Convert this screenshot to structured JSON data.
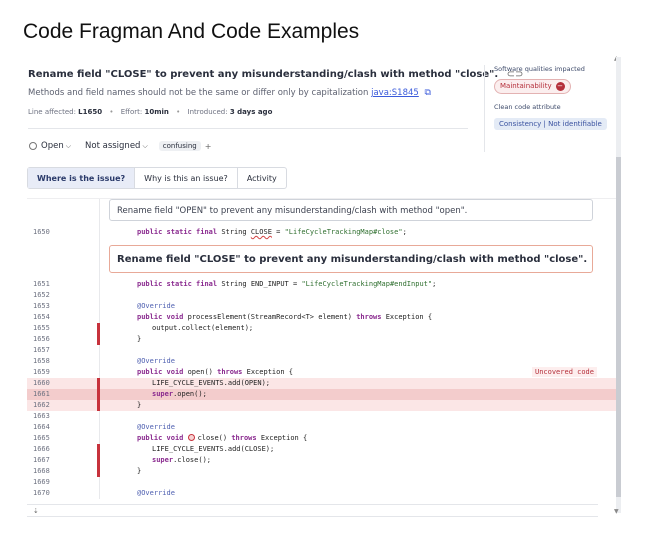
{
  "page_title": "Code Fragman And Code Examples",
  "issue": {
    "title": "Rename field \"CLOSE\" to prevent any misunderstanding/clash with method \"close\".",
    "description": "Methods and field names should not be the same or differ only by capitalization",
    "rule": "java:S1845",
    "line_label": "Line affected:",
    "line_value": "L1650",
    "effort_label": "Effort:",
    "effort_value": "10min",
    "introduced_label": "Introduced:",
    "introduced_value": "3 days ago",
    "status": "Open",
    "assignee": "Not assigned",
    "tag": "confusing",
    "tag_add": "+"
  },
  "tabs": [
    {
      "label": "Where is the issue?",
      "active": true
    },
    {
      "label": "Why is this an issue?",
      "active": false
    },
    {
      "label": "Activity",
      "active": false
    }
  ],
  "side": {
    "qualities_label": "Software qualities impacted",
    "quality_badge": "Maintainability",
    "attribute_label": "Clean code attribute",
    "attribute_badge": "Consistency | Not identifiable"
  },
  "code": {
    "secondary_message": "Rename field \"OPEN\" to prevent any misunderstanding/clash with method \"open\".",
    "primary_message": "Rename field \"CLOSE\" to prevent any misunderstanding/clash with method \"close\".",
    "uncovered_label": "Uncovered code",
    "lines": {
      "l1650": {
        "n": "1650"
      },
      "l1651": {
        "n": "1651"
      },
      "l1652": {
        "n": "1652"
      },
      "l1653": {
        "n": "1653"
      },
      "l1654": {
        "n": "1654"
      },
      "l1655": {
        "n": "1655"
      },
      "l1656": {
        "n": "1656"
      },
      "l1657": {
        "n": "1657"
      },
      "l1658": {
        "n": "1658"
      },
      "l1659": {
        "n": "1659"
      },
      "l1660": {
        "n": "1660"
      },
      "l1661": {
        "n": "1661"
      },
      "l1662": {
        "n": "1662"
      },
      "l1663": {
        "n": "1663"
      },
      "l1664": {
        "n": "1664"
      },
      "l1665": {
        "n": "1665"
      },
      "l1666": {
        "n": "1666"
      },
      "l1667": {
        "n": "1667"
      },
      "l1668": {
        "n": "1668"
      },
      "l1669": {
        "n": "1669"
      },
      "l1670": {
        "n": "1670"
      }
    },
    "src": {
      "kw_public": "public",
      "kw_static": "static",
      "kw_final": "final",
      "kw_void": "void",
      "kw_throws": "throws",
      "kw_super": "super",
      "type_string": "String",
      "close_field": "CLOSE",
      "close_str": "\"LifeCycleTrackingMap#close\"",
      "end_input": "END_INPUT",
      "end_input_str": "\"LifeCycleTrackingMap#endInput\"",
      "override": "@Override",
      "process_sig": "processElement(StreamRecord<T> element)",
      "exception": "Exception {",
      "collect": "output.collect(element);",
      "brace": "}",
      "open_sig": "open()",
      "add_open": "LIFE_CYCLE_EVENTS.add(OPEN);",
      "super_open": ".open();",
      "close_sig": "close()",
      "add_close": "LIFE_CYCLE_EVENTS.add(CLOSE);",
      "super_close": ".close();",
      "assign": "=",
      "semi": ";"
    }
  }
}
